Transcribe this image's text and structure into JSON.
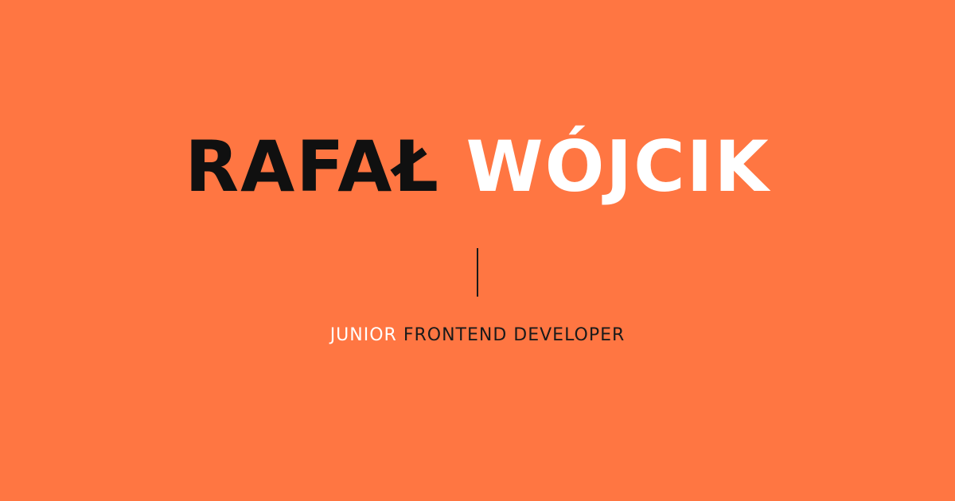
{
  "name": {
    "first": "RAFAŁ",
    "last": "WÓJCIK"
  },
  "role": {
    "level": "JUNIOR",
    "title": "FRONTEND DEVELOPER"
  },
  "colors": {
    "background": "#FF7642",
    "dark_text": "#101010",
    "light_text": "#FFFFFF"
  }
}
